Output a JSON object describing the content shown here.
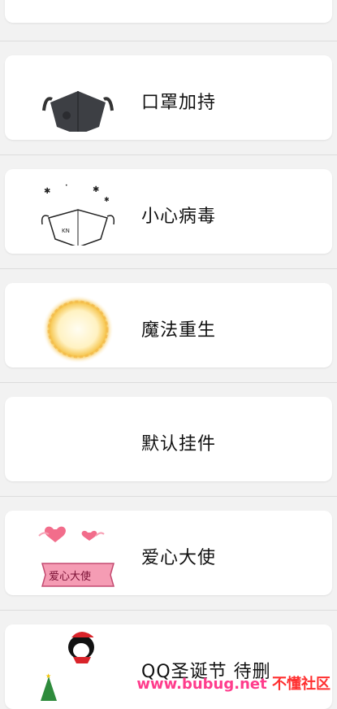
{
  "items": [
    {
      "label": "口罩加持",
      "icon": "black-mask-icon"
    },
    {
      "label": "小心病毒",
      "icon": "outline-mask-icon"
    },
    {
      "label": "魔法重生",
      "icon": "golden-glow-ring-icon"
    },
    {
      "label": "默认挂件",
      "icon": ""
    },
    {
      "label": "爱心大使",
      "icon": "love-ambassador-icon",
      "banner": "爱心大使"
    },
    {
      "label": "QQ圣诞节 待删",
      "icon": "qq-christmas-icon"
    }
  ],
  "watermark": {
    "site": "www.bubug.net",
    "brand": "不懂社区"
  }
}
